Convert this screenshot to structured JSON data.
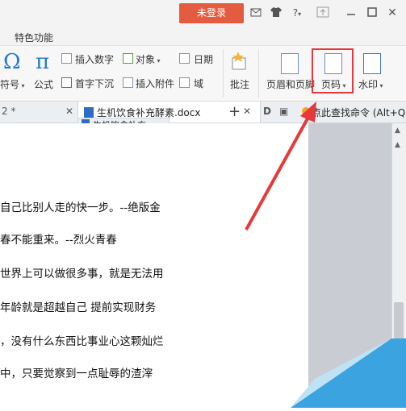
{
  "titlebar": {
    "login_label": "未登录",
    "icons": [
      "envelope-icon",
      "shirt-icon",
      "help-icon",
      "upload-icon",
      "minimize-icon",
      "maximize-icon",
      "close-icon"
    ],
    "help_glyph": "?",
    "close_glyph": "✕"
  },
  "menu": {
    "feature_tab": "特色功能"
  },
  "ribbon": {
    "omega_glyph": "Ω",
    "pi_glyph": "π",
    "symbol_label": "符号",
    "formula_label": "公式",
    "insert_number": "插入数字",
    "object": "对象",
    "date": "日期",
    "dropcap": "首字下沉",
    "attachment": "插入附件",
    "field": "域",
    "comment": "批注",
    "header_footer": "页眉和页脚",
    "page_number": "页码",
    "watermark": "水印"
  },
  "tabs": {
    "left_partial": "2 *",
    "doc_tab": "生机饮食补充酵素.docx",
    "doc_tab2": "生机饮食补充",
    "add": "+",
    "search_cmd": "点此查找命令 (Alt+Q)"
  },
  "doc": {
    "lines": [
      "自己比别人走的快一步。--绝版金",
      "春不能重来。--烈火青春",
      "世界上可以做很多事，就是无法用",
      "年龄就是超越自己 提前实现财务",
      "，没有什么东西比事业心这颗灿烂",
      "中，只要觉察到一点耻辱的渣滓"
    ]
  },
  "colors": {
    "accent": "#e45c3f",
    "highlight": "#e63a3a",
    "brand_blue": "#1f7ad6"
  }
}
